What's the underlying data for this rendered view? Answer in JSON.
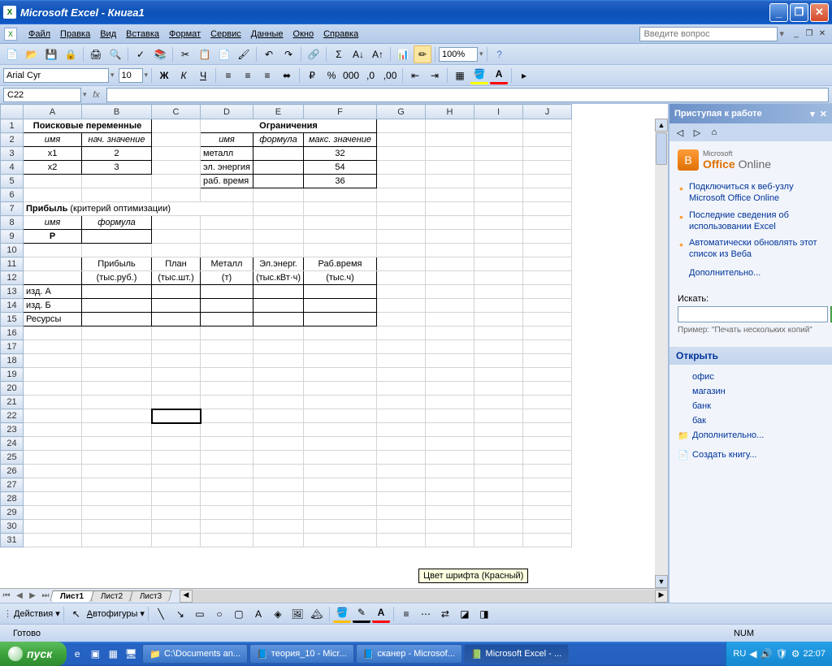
{
  "titlebar": {
    "title": "Microsoft Excel - Книга1"
  },
  "menu": {
    "file": "Файл",
    "edit": "Правка",
    "view": "Вид",
    "insert": "Вставка",
    "format": "Формат",
    "tools": "Сервис",
    "data": "Данные",
    "window": "Окно",
    "help": "Справка",
    "ask": "Введите вопрос"
  },
  "toolbar2": {
    "font": "Arial Cyr",
    "size": "10",
    "zoom": "100%"
  },
  "formula": {
    "namebox": "C22"
  },
  "cols": [
    "A",
    "B",
    "C",
    "D",
    "E",
    "F",
    "G",
    "H",
    "I",
    "J"
  ],
  "rowcount": 31,
  "cells": {
    "A1F1_title1": "Поисковые переменные",
    "D1F1_title2": "Ограничения",
    "A2": "имя",
    "B2": "нач. значение",
    "D2": "имя",
    "E2": "формула",
    "F2": "макс. значение",
    "A3": "x1",
    "B3": "2",
    "D3": "металл",
    "F3": "32",
    "A4": "x2",
    "B4": "3",
    "D4": "эл. энергия",
    "F4": "54",
    "D5": "раб. время",
    "F5": "36",
    "A7a": "Прибыль",
    "A7b": "(критерий оптимизации)",
    "A8": "имя",
    "B8": "формула",
    "A9": "P",
    "B11": "Прибыль",
    "C11": "План",
    "D11": "Металл",
    "E11": "Эл.энерг.",
    "F11": "Раб.время",
    "B12": "(тыс.руб.)",
    "C12": "(тыс.шт.)",
    "D12": "(т)",
    "E12": "(тыс.кВт·ч)",
    "F12": "(тыс.ч)",
    "A13": "изд. А",
    "A14": "изд. Б",
    "A15": "Ресурсы"
  },
  "sheets": {
    "s1": "Лист1",
    "s2": "Лист2",
    "s3": "Лист3"
  },
  "drawbar": {
    "actions": "Действия",
    "autoshapes": "Автофигуры"
  },
  "tooltip": "Цвет шрифта (Красный)",
  "status": {
    "ready": "Готово",
    "num": "NUM"
  },
  "taskpane": {
    "title": "Приступая к работе",
    "logo_brand": "Microsoft",
    "logo": "Office Online",
    "links": {
      "l1": "Подключиться к веб-узлу Microsoft Office Online",
      "l2": "Последние сведения об использовании Excel",
      "l3": "Автоматически обновлять этот список из Веба",
      "more": "Дополнительно..."
    },
    "search_label": "Искать:",
    "example": "Пример: \"Печать нескольких копий\"",
    "open": "Открыть",
    "files": {
      "f1": "офис",
      "f2": "магазин",
      "f3": "банк",
      "f4": "бак"
    },
    "more2": "Дополнительно...",
    "create": "Создать книгу..."
  },
  "taskbar": {
    "start": "пуск",
    "b1": "C:\\Documents an...",
    "b2": "теория_10 - Micr...",
    "b3": "сканер - Microsof...",
    "b4": "Microsoft Excel - ...",
    "lang": "RU",
    "time": "22:07"
  }
}
